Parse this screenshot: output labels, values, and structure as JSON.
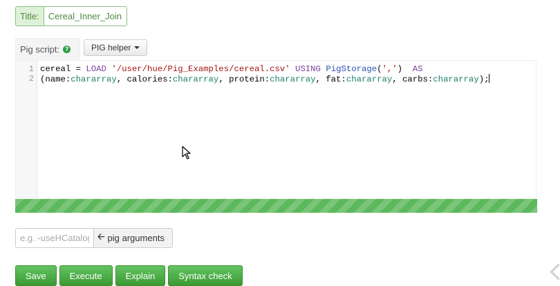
{
  "title": {
    "label": "Title:",
    "value": "Cereal_Inner_Join"
  },
  "script_tab": {
    "label": "Pig script:",
    "help_icon": "question-circle-icon"
  },
  "helper_button": {
    "label": "PIG helper"
  },
  "editor": {
    "line_numbers": [
      "1",
      "2"
    ],
    "line1": {
      "t1": "cereal = ",
      "t2": "LOAD",
      "t3": " ",
      "t4": "'/user/hue/Pig_Examples/cereal.csv'",
      "t5": " ",
      "t6": "USING",
      "t7": " ",
      "t8": "PigStorage",
      "t9": "(",
      "t10": "','",
      "t11": ")  ",
      "t12": "AS"
    },
    "line2": {
      "t1": "(name:",
      "t2": "chararray",
      "t3": ", calories:",
      "t4": "chararray",
      "t5": ", protein:",
      "t6": "chararray",
      "t7": ", fat:",
      "t8": "chararray",
      "t9": ", carbs:",
      "t10": "chararray",
      "t11": ");"
    }
  },
  "progress": {
    "percent": 100,
    "color": "#5cb85c"
  },
  "arguments": {
    "placeholder": "e.g. -useHCatalog",
    "button_label": "pig arguments",
    "button_icon": "arrow-left-icon"
  },
  "actions": {
    "save": "Save",
    "execute": "Execute",
    "explain": "Explain",
    "syntax_check": "Syntax check"
  },
  "colors": {
    "accent_green": "#5cb85c",
    "title_border": "#8bc37f"
  }
}
